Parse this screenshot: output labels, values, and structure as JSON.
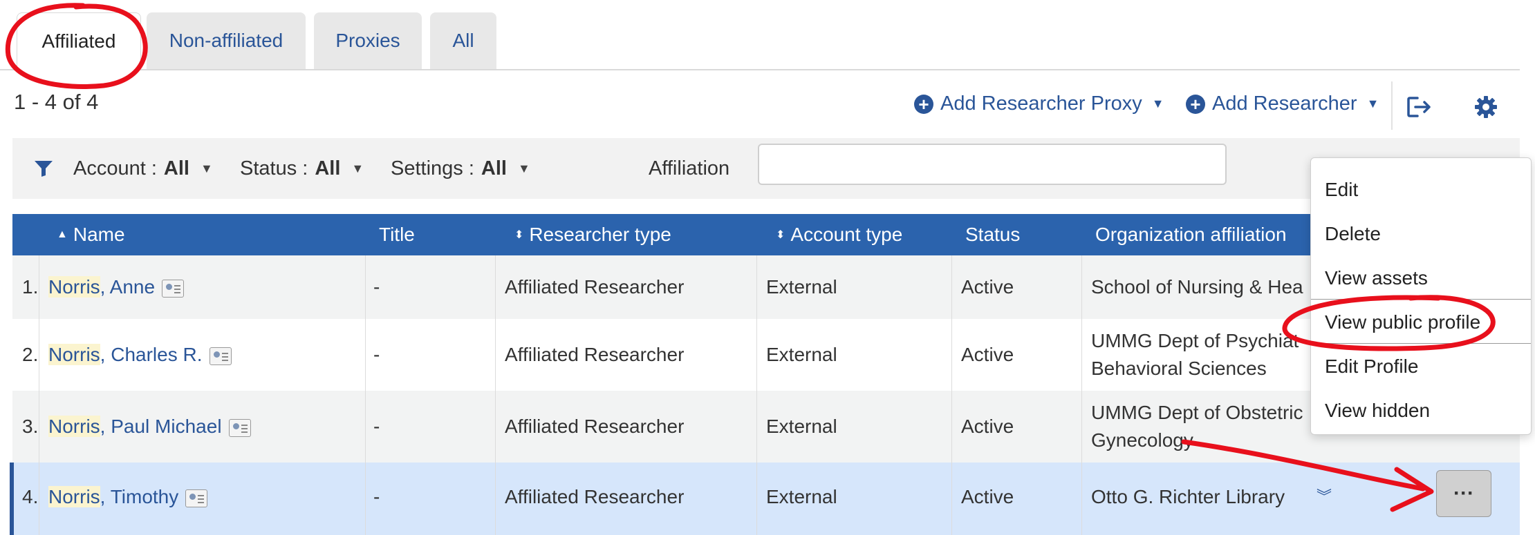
{
  "tabs": [
    "Affiliated",
    "Non-affiliated",
    "Proxies",
    "All"
  ],
  "result_count": "1 - 4 of 4",
  "actions": {
    "add_proxy": "Add Researcher Proxy",
    "add_researcher": "Add Researcher"
  },
  "filters": {
    "account_label": "Account :",
    "account_value": "All",
    "status_label": "Status :",
    "status_value": "All",
    "settings_label": "Settings :",
    "settings_value": "All",
    "affiliation_label": "Affiliation",
    "affiliation_value": ""
  },
  "columns": [
    "Name",
    "Title",
    "Researcher type",
    "Account type",
    "Status",
    "Organization affiliation"
  ],
  "rows": [
    {
      "num": "1.",
      "name_hl": "Norris",
      "name_rest": ", Anne",
      "title": "-",
      "type": "Affiliated Researcher",
      "account": "External",
      "status": "Active",
      "org1": "School of Nursing & Hea",
      "org2": ""
    },
    {
      "num": "2.",
      "name_hl": "Norris",
      "name_rest": ", Charles R.",
      "title": "-",
      "type": "Affiliated Researcher",
      "account": "External",
      "status": "Active",
      "org1": "UMMG Dept of Psychiat",
      "org2": "Behavioral Sciences"
    },
    {
      "num": "3.",
      "name_hl": "Norris",
      "name_rest": ", Paul Michael",
      "title": "-",
      "type": "Affiliated Researcher",
      "account": "External",
      "status": "Active",
      "org1": "UMMG Dept of Obstetric",
      "org2": "Gynecology"
    },
    {
      "num": "4.",
      "name_hl": "Norris",
      "name_rest": ", Timothy",
      "title": "-",
      "type": "Affiliated Researcher",
      "account": "External",
      "status": "Active",
      "org1": "Otto G. Richter Library",
      "org2": ""
    }
  ],
  "menu": [
    "Edit",
    "Delete",
    "View assets",
    "View public profile",
    "Edit Profile",
    "View hidden"
  ],
  "more_button": "···",
  "colors": {
    "accent": "#2a5598",
    "header_bg": "#2b63ad",
    "selected_row": "#d6e6fb",
    "annotation": "#e8101c"
  }
}
